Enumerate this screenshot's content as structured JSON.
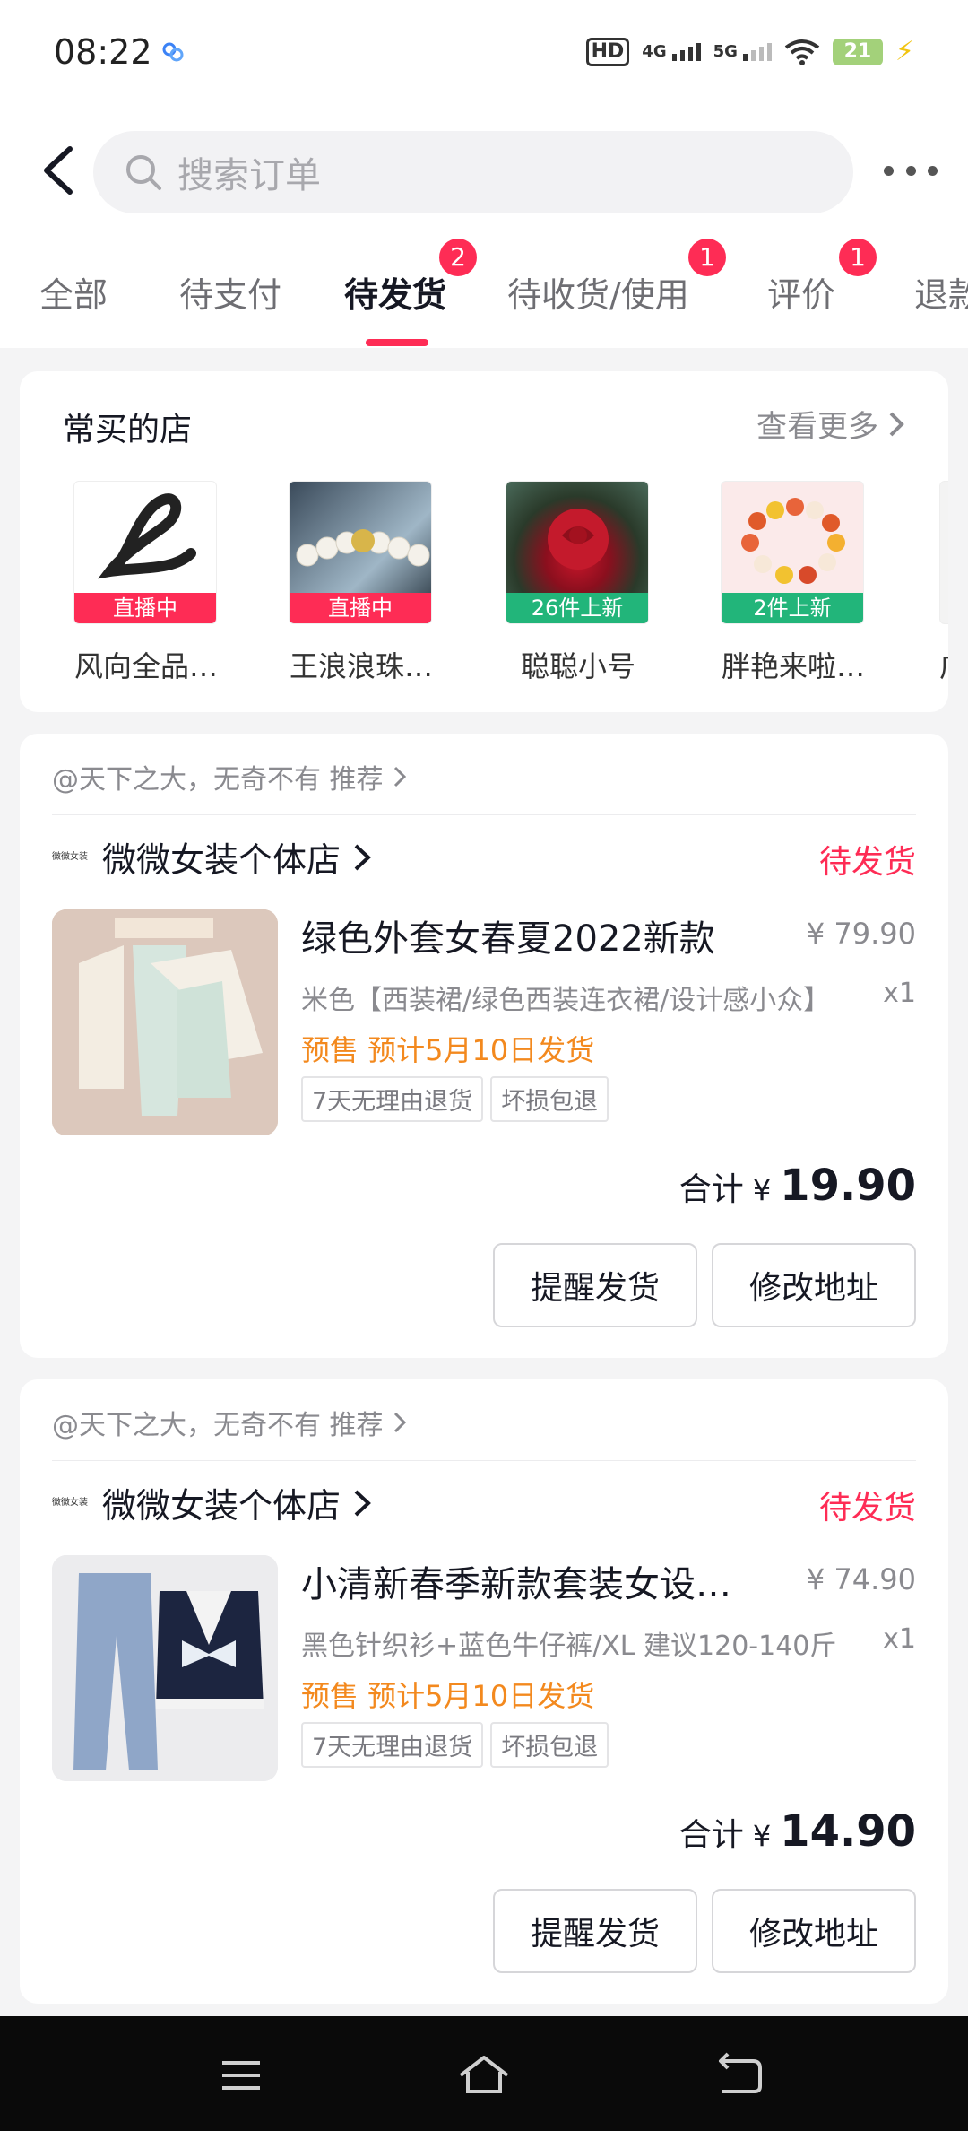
{
  "status_bar": {
    "time": "08:22",
    "hd_label": "HD",
    "net1": "4G",
    "net2": "5G",
    "battery": "21"
  },
  "search": {
    "placeholder": "搜索订单"
  },
  "tabs": [
    {
      "label": "全部"
    },
    {
      "label": "待支付"
    },
    {
      "label": "待发货",
      "badge": "2",
      "active": true
    },
    {
      "label": "待收货/使用",
      "badge": "1"
    },
    {
      "label": "评价",
      "badge": "1"
    },
    {
      "label": "退款"
    }
  ],
  "frequent_shops": {
    "title": "常买的店",
    "more": "查看更多",
    "shops": [
      {
        "name": "风向全品…",
        "tag": "直播中"
      },
      {
        "name": "王浪浪珠…",
        "tag": "直播中"
      },
      {
        "name": "聪聪小号",
        "tag": "26件上新"
      },
      {
        "name": "胖艳来啦…",
        "tag": "2件上新"
      },
      {
        "name": "广"
      }
    ]
  },
  "orders": [
    {
      "recommend": "@天下之大，无奇不有 推荐",
      "store_logo": "微微女装",
      "store": "微微女装个体店",
      "status": "待发货",
      "title": "绿色外套女春夏2022新款",
      "price": "¥ 79.90",
      "spec": "米色【西装裙/绿色西装连衣裙/设计感小众】",
      "qty": "x1",
      "presale": "预售 预计5月10日发货",
      "chips": [
        "7天无理由退货",
        "坏损包退"
      ],
      "total_label": "合计",
      "currency": "¥",
      "total": "19.90",
      "btn1": "提醒发货",
      "btn2": "修改地址"
    },
    {
      "recommend": "@天下之大，无奇不有 推荐",
      "store_logo": "微微女装",
      "store": "微微女装个体店",
      "status": "待发货",
      "title": "小清新春季新款套装女设计感",
      "price": "¥ 74.90",
      "spec": "黑色针织衫+蓝色牛仔裤/XL 建议120-140斤",
      "qty": "x1",
      "presale": "预售 预计5月10日发货",
      "chips": [
        "7天无理由退货",
        "坏损包退"
      ],
      "total_label": "合计",
      "currency": "¥",
      "total": "14.90",
      "btn1": "提醒发货",
      "btn2": "修改地址"
    }
  ],
  "colors": {
    "accent": "#fe2c55",
    "presale": "#f3891e",
    "new_tag": "#22b57a"
  }
}
